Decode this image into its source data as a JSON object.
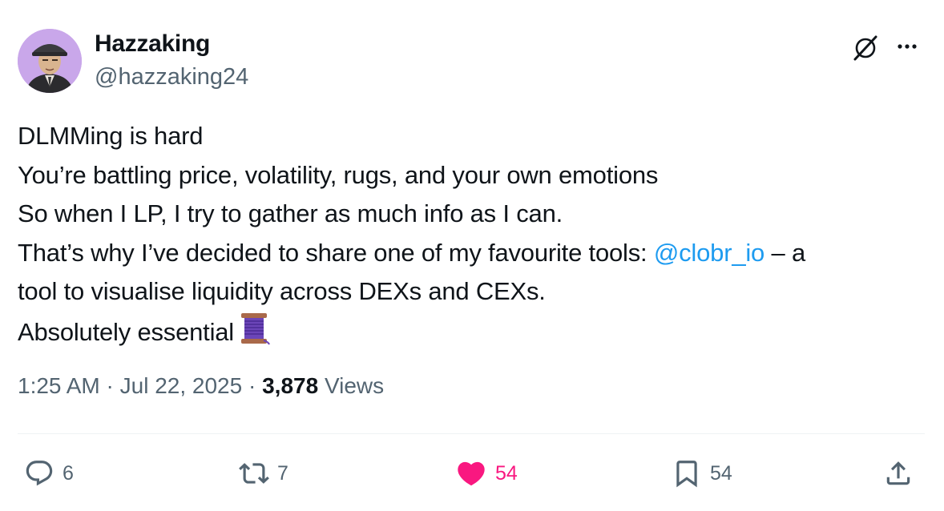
{
  "author": {
    "display_name": "Hazzaking",
    "handle": "@hazzaking24",
    "avatar_icon": "avatar-portrait"
  },
  "header_actions": {
    "grok_icon": "grok-icon",
    "more_icon": "more-horizontal-icon"
  },
  "tweet": {
    "line1": "DLMMing is hard",
    "line2": "You’re battling price, volatility, rugs, and your own emotions",
    "line3": "So when I LP, I try to gather as much info as I can.",
    "line4_before": "That’s why I’ve decided to share one of my favourite tools: ",
    "mention": "@clobr_io",
    "line4_after": " – a",
    "line5": "tool to visualise liquidity across DEXs and CEXs.",
    "line6": "Absolutely essential",
    "emoji": "thread-spool-emoji"
  },
  "meta": {
    "time": "1:25 AM",
    "separator": " · ",
    "date": "Jul 22, 2025",
    "views_count": "3,878",
    "views_label": "Views"
  },
  "actions": {
    "replies": "6",
    "reposts": "7",
    "likes": "54",
    "bookmarks": "54"
  },
  "colors": {
    "text": "#0f1419",
    "secondary": "#536471",
    "link": "#1d9bf0",
    "like": "#f91880",
    "divider": "#eff3f4"
  }
}
